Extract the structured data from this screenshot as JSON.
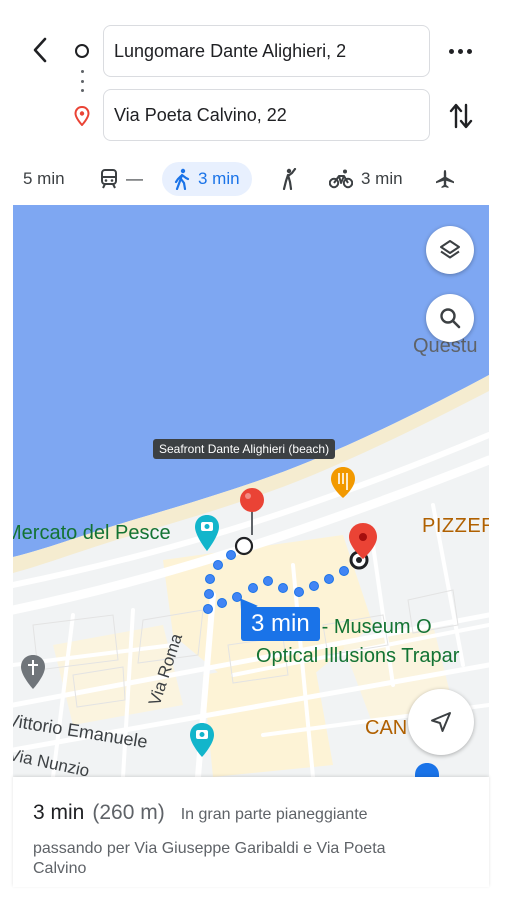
{
  "header": {
    "origin": "Lungomare Dante Alighieri, 2",
    "destination": "Via Poeta Calvino, 22"
  },
  "modes": [
    {
      "name": "drive",
      "icon": "car-icon",
      "label": "5 min"
    },
    {
      "name": "transit",
      "icon": "train-icon",
      "label": "—"
    },
    {
      "name": "walk",
      "icon": "walk-icon",
      "label": "3 min",
      "active": true
    },
    {
      "name": "ride",
      "icon": "ride-hail-icon",
      "label": ""
    },
    {
      "name": "bike",
      "icon": "bike-icon",
      "label": "3 min"
    },
    {
      "name": "flight",
      "icon": "airplane-icon",
      "label": ""
    }
  ],
  "map": {
    "labels": {
      "questura": "Questu",
      "tooltip": "Seafront Dante Alighieri (beach)",
      "mercato": "Mercato del Pesce",
      "pizzer": "PIZZER",
      "museum_line1": "OI - Museum O",
      "museum_line2": "Optical Illusions Trapar",
      "vittorio": "Vittorio Emanuele",
      "nunzio": "Via Nunzio",
      "via_roma": "Via Roma",
      "cam": "CAN"
    },
    "time_badge": "3 min",
    "colors": {
      "sea": "#7ea7f2",
      "land": "#f1f3f4",
      "route": "#1a73e8",
      "pin": "#ea4335"
    }
  },
  "summary": {
    "duration": "3 min",
    "distance": "(260 m)",
    "terrain": "In gran parte pianeggiante",
    "via": "passando per Via Giuseppe Garibaldi e Via Poeta Calvino"
  }
}
